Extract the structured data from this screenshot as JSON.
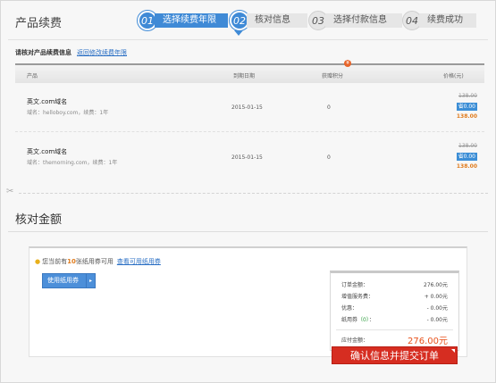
{
  "page": {
    "title": "产品续费"
  },
  "steps": [
    {
      "num": "01",
      "label": "选择续费年限"
    },
    {
      "num": "02",
      "label": "核对信息"
    },
    {
      "num": "03",
      "label": "选择付款信息"
    },
    {
      "num": "04",
      "label": "续费成功"
    }
  ],
  "products": {
    "heading": "请核对产品续费信息",
    "link": "返回修改续费年限",
    "headers": {
      "product": "产品",
      "expire": "到期日期",
      "points": "获赠积分",
      "price": "价格(元)"
    },
    "points_badge": "¥",
    "rows": [
      {
        "name": "英文.com域名",
        "sub": "域名：helloboy.com，续费：1年",
        "date": "2015-01-15",
        "points": "0",
        "old_price": "138.00",
        "save": "省0.00",
        "price": "138.00"
      },
      {
        "name": "英文.com域名",
        "sub": "域名：themorning.com，续费：1年",
        "date": "2015-01-15",
        "points": "0",
        "old_price": "138.00",
        "save": "省0.00",
        "price": "138.00"
      }
    ]
  },
  "amount": {
    "heading": "核对金额",
    "tip_prefix": "您当前有",
    "coupon_count": "10",
    "tip_suffix": "张纸用券可用",
    "view_link": "查看可用纸用券",
    "use_button": "使用纸用券",
    "summary": {
      "order_label": "订单金额：",
      "order_value": "276.00元",
      "service_label": "增值服务费：",
      "service_value": "+ 0.00元",
      "discount_label": "优惠：",
      "discount_value": "- 0.00元",
      "coupon_label": "纸用券",
      "coupon_count": "（0）",
      "coupon_colon": "：",
      "coupon_value": "- 0.00元",
      "total_label": "应付金额：",
      "total_value": "276.00元"
    },
    "submit": "确认信息并提交订单"
  }
}
